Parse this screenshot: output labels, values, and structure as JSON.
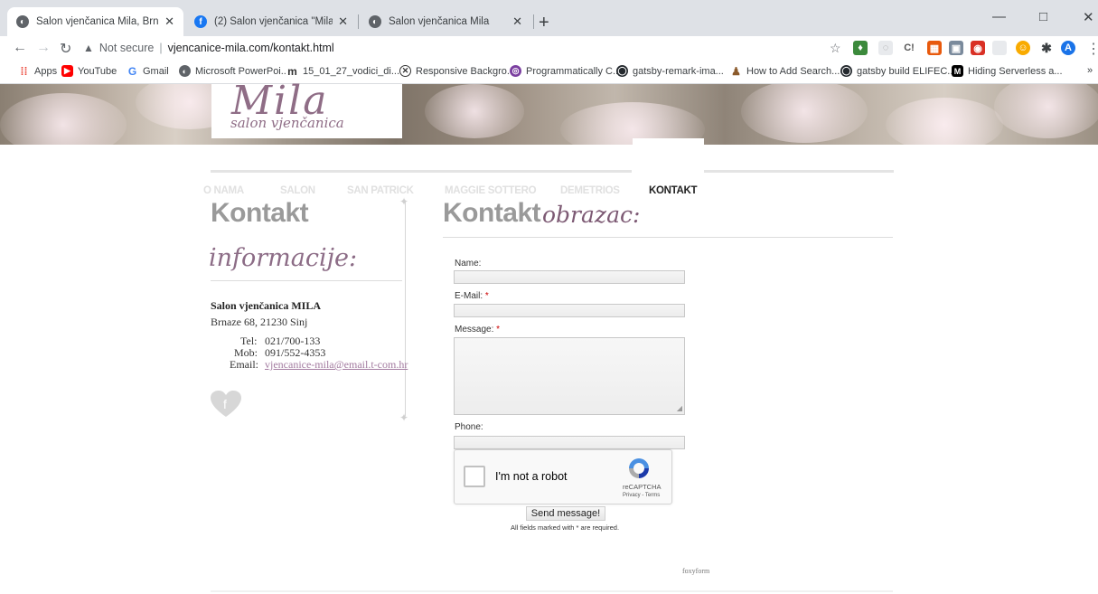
{
  "browser": {
    "tabs": [
      {
        "title": "Salon vjenčanica Mila, Brnaze - S",
        "icon": "globe-icon",
        "active": true
      },
      {
        "title": "(2) Salon vjenčanica \"Mila\" | Face",
        "icon": "facebook-icon",
        "active": false
      },
      {
        "title": "Salon vjenčanica Mila",
        "icon": "globe-icon",
        "active": false
      }
    ],
    "new_tab": "+",
    "window_controls": {
      "minimize": "—",
      "maximize": "□",
      "close": "✕"
    },
    "security": "Not secure",
    "url": "vjencanice-mila.com/kontakt.html",
    "bookmarks": [
      "Apps",
      "YouTube",
      "Gmail",
      "Microsoft PowerPoi...",
      "15_01_27_vodici_di...",
      "Responsive Backgro...",
      "Programmatically C...",
      "gatsby-remark-ima...",
      "How to Add Search...",
      "gatsby build ELIFEC...",
      "Hiding Serverless a..."
    ],
    "bookmarks_more": "»",
    "profile_initial": "A"
  },
  "site": {
    "logo_main": "Mila",
    "logo_sub": "salon vjenčanica",
    "nav": [
      {
        "label": "O NAMA",
        "active": false
      },
      {
        "label": "SALON",
        "active": false
      },
      {
        "label": "SAN PATRICK",
        "active": false
      },
      {
        "label": "MAGGIE SOTTERO",
        "active": false
      },
      {
        "label": "DEMETRIOS",
        "active": false
      },
      {
        "label": "KONTAKT",
        "active": true
      }
    ],
    "left_heading": "Kontakt",
    "left_subheading": "informacije:",
    "right_heading": "Kontakt",
    "right_heading_script": "obrazac:",
    "info": {
      "name": "Salon vjenčanica MILA",
      "address": "Brnaze 68, 21230 Sinj",
      "tel_label": "Tel:",
      "tel": "021/700-133",
      "mob_label": "Mob:",
      "mob": "091/552-4353",
      "email_label": "Email:",
      "email": "vjencanice-mila@email.t-com.hr"
    },
    "facebook_letter": "f",
    "form": {
      "name_label": "Name:",
      "email_label": "E-Mail:",
      "message_label": "Message:",
      "phone_label": "Phone:",
      "required_mark": "*",
      "captcha_text": "I'm not a robot",
      "captcha_brand": "reCAPTCHA",
      "captcha_links": "Privacy - Terms",
      "send_label": "Send message!",
      "required_note": "All fields marked with * are required."
    },
    "footer_credit": "foxyform"
  }
}
